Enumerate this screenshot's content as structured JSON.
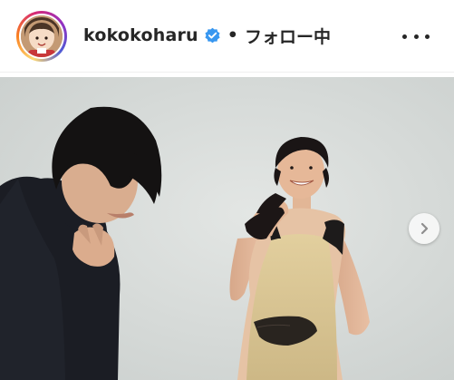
{
  "post_header": {
    "username": "kokokoharu",
    "separator": "•",
    "follow_status": "フォロー中",
    "verified_badge_icon": "verified-check-icon",
    "more_options_icon": "three-dots-icon"
  },
  "carousel": {
    "next_icon": "chevron-right-icon"
  },
  "colors": {
    "verified_blue": "#3897f0",
    "photo_background": "#d9dddb"
  }
}
